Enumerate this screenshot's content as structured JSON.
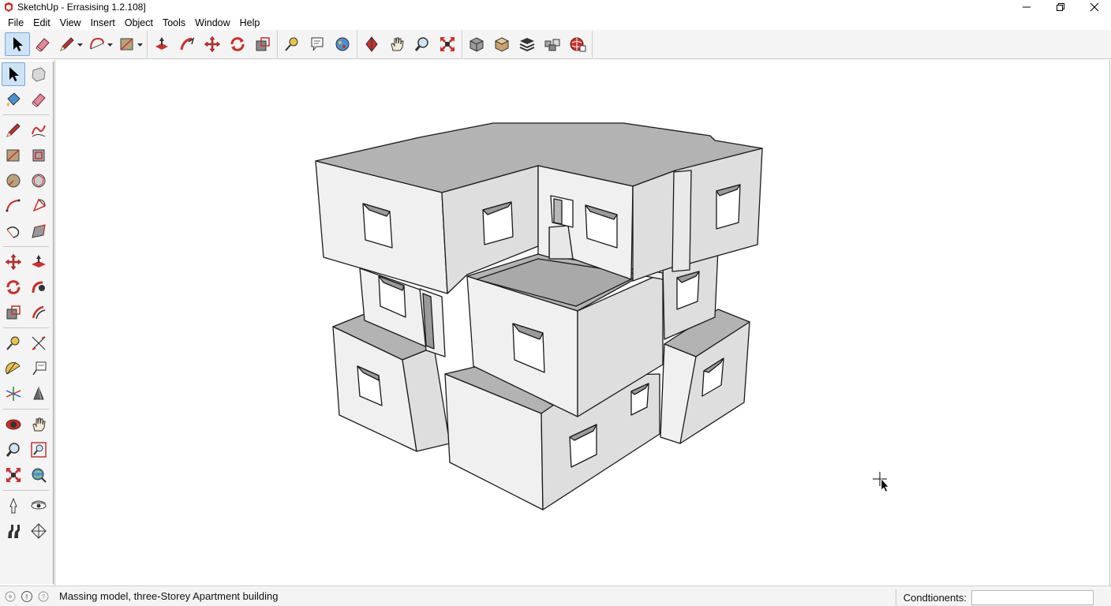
{
  "window": {
    "title": "SketchUp - Errasising 1.2.108]"
  },
  "menu": {
    "items": [
      "File",
      "Edit",
      "View",
      "Insert",
      "Object",
      "Tools",
      "Window",
      "Help"
    ]
  },
  "toolbar": {
    "groups": [
      [
        "select-icon",
        "eraser-icon",
        "pencil-icon",
        "arc-icon",
        "rectangle-icon"
      ],
      [
        "push-pull-icon",
        "follow-me-icon",
        "move-icon",
        "rotate-icon",
        "scale-icon"
      ],
      [
        "tape-measure-icon",
        "text-icon",
        "paint-bucket-icon"
      ],
      [
        "orbit-icon",
        "pan-icon",
        "zoom-icon",
        "zoom-extents-icon"
      ],
      [
        "iso-view-icon",
        "top-view-icon",
        "layers-icon",
        "components-icon",
        "warehouse-icon"
      ]
    ],
    "active": "select-icon"
  },
  "left_toolbar": {
    "rows": [
      [
        "select-icon",
        "component-icon"
      ],
      [
        "paint-bucket-icon",
        "eraser-icon"
      ],
      [
        "pencil-icon",
        "freehand-icon"
      ],
      [
        "rectangle-icon",
        "rotated-rectangle-icon"
      ],
      [
        "circle-icon",
        "polygon-icon"
      ],
      [
        "arc-icon",
        "pie-icon"
      ],
      [
        "two-point-arc-icon",
        "offset-plane-icon"
      ],
      [
        "move-icon",
        "push-pull-icon"
      ],
      [
        "rotate-icon",
        "follow-me-icon"
      ],
      [
        "scale-icon",
        "offset-icon"
      ],
      [
        "tape-measure-icon",
        "dimension-icon"
      ],
      [
        "protractor-icon",
        "text-icon"
      ],
      [
        "axes-icon",
        "section-plane-icon"
      ],
      [
        "orbit-icon",
        "pan-icon"
      ],
      [
        "zoom-icon",
        "zoom-window-icon"
      ],
      [
        "zoom-extents-icon",
        "previous-view-icon"
      ],
      [
        "position-camera-icon",
        "look-around-icon"
      ],
      [
        "walk-icon",
        "sandbox-icon"
      ]
    ],
    "active": "select-icon"
  },
  "status": {
    "message": "Massing model, three-Storey Apartment building",
    "measurements_label": "Condtionents:",
    "measurements_value": ""
  },
  "colors": {
    "toolbar_bg": "#f4f4f4",
    "active_tool_bg": "#cfe3f7",
    "face_top": "#b3b3b3",
    "face_front": "#f0f0f0",
    "face_side": "#dedede",
    "edge": "#1a1a1a",
    "brand_red": "#c9302c"
  }
}
